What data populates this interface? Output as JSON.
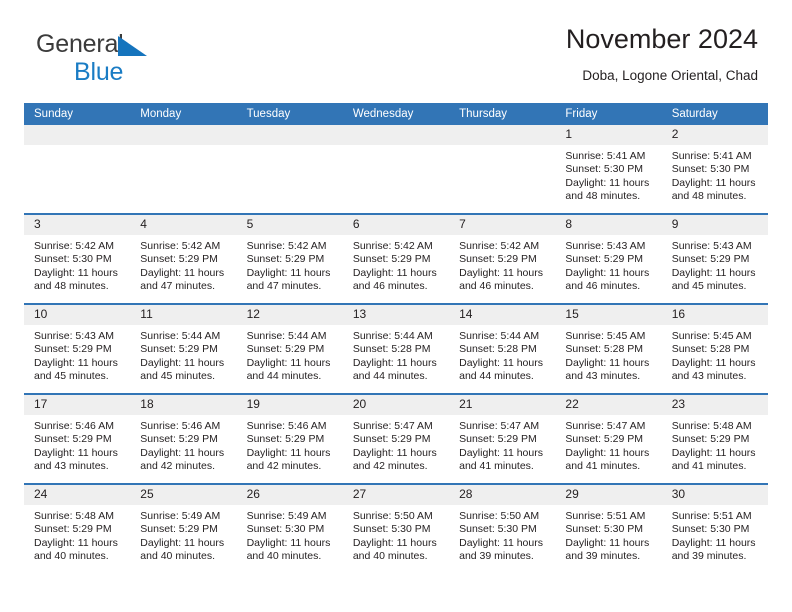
{
  "brand": {
    "name_top": "General",
    "name_bottom": "Blue",
    "triangle_color": "#1574bd",
    "text_color": "#3b3b3b",
    "blue_color": "#1a7cc4"
  },
  "header": {
    "title": "November 2024",
    "subtitle": "Doba, Logone Oriental, Chad",
    "accent_color": "#3275b6",
    "daynum_bg": "#efefef"
  },
  "weekday_headers": [
    "Sunday",
    "Monday",
    "Tuesday",
    "Wednesday",
    "Thursday",
    "Friday",
    "Saturday"
  ],
  "weeks": [
    [
      {
        "day": "",
        "lines": []
      },
      {
        "day": "",
        "lines": []
      },
      {
        "day": "",
        "lines": []
      },
      {
        "day": "",
        "lines": []
      },
      {
        "day": "",
        "lines": []
      },
      {
        "day": "1",
        "lines": [
          "Sunrise: 5:41 AM",
          "Sunset: 5:30 PM",
          "Daylight: 11 hours",
          "and 48 minutes."
        ]
      },
      {
        "day": "2",
        "lines": [
          "Sunrise: 5:41 AM",
          "Sunset: 5:30 PM",
          "Daylight: 11 hours",
          "and 48 minutes."
        ]
      }
    ],
    [
      {
        "day": "3",
        "lines": [
          "Sunrise: 5:42 AM",
          "Sunset: 5:30 PM",
          "Daylight: 11 hours",
          "and 48 minutes."
        ]
      },
      {
        "day": "4",
        "lines": [
          "Sunrise: 5:42 AM",
          "Sunset: 5:29 PM",
          "Daylight: 11 hours",
          "and 47 minutes."
        ]
      },
      {
        "day": "5",
        "lines": [
          "Sunrise: 5:42 AM",
          "Sunset: 5:29 PM",
          "Daylight: 11 hours",
          "and 47 minutes."
        ]
      },
      {
        "day": "6",
        "lines": [
          "Sunrise: 5:42 AM",
          "Sunset: 5:29 PM",
          "Daylight: 11 hours",
          "and 46 minutes."
        ]
      },
      {
        "day": "7",
        "lines": [
          "Sunrise: 5:42 AM",
          "Sunset: 5:29 PM",
          "Daylight: 11 hours",
          "and 46 minutes."
        ]
      },
      {
        "day": "8",
        "lines": [
          "Sunrise: 5:43 AM",
          "Sunset: 5:29 PM",
          "Daylight: 11 hours",
          "and 46 minutes."
        ]
      },
      {
        "day": "9",
        "lines": [
          "Sunrise: 5:43 AM",
          "Sunset: 5:29 PM",
          "Daylight: 11 hours",
          "and 45 minutes."
        ]
      }
    ],
    [
      {
        "day": "10",
        "lines": [
          "Sunrise: 5:43 AM",
          "Sunset: 5:29 PM",
          "Daylight: 11 hours",
          "and 45 minutes."
        ]
      },
      {
        "day": "11",
        "lines": [
          "Sunrise: 5:44 AM",
          "Sunset: 5:29 PM",
          "Daylight: 11 hours",
          "and 45 minutes."
        ]
      },
      {
        "day": "12",
        "lines": [
          "Sunrise: 5:44 AM",
          "Sunset: 5:29 PM",
          "Daylight: 11 hours",
          "and 44 minutes."
        ]
      },
      {
        "day": "13",
        "lines": [
          "Sunrise: 5:44 AM",
          "Sunset: 5:28 PM",
          "Daylight: 11 hours",
          "and 44 minutes."
        ]
      },
      {
        "day": "14",
        "lines": [
          "Sunrise: 5:44 AM",
          "Sunset: 5:28 PM",
          "Daylight: 11 hours",
          "and 44 minutes."
        ]
      },
      {
        "day": "15",
        "lines": [
          "Sunrise: 5:45 AM",
          "Sunset: 5:28 PM",
          "Daylight: 11 hours",
          "and 43 minutes."
        ]
      },
      {
        "day": "16",
        "lines": [
          "Sunrise: 5:45 AM",
          "Sunset: 5:28 PM",
          "Daylight: 11 hours",
          "and 43 minutes."
        ]
      }
    ],
    [
      {
        "day": "17",
        "lines": [
          "Sunrise: 5:46 AM",
          "Sunset: 5:29 PM",
          "Daylight: 11 hours",
          "and 43 minutes."
        ]
      },
      {
        "day": "18",
        "lines": [
          "Sunrise: 5:46 AM",
          "Sunset: 5:29 PM",
          "Daylight: 11 hours",
          "and 42 minutes."
        ]
      },
      {
        "day": "19",
        "lines": [
          "Sunrise: 5:46 AM",
          "Sunset: 5:29 PM",
          "Daylight: 11 hours",
          "and 42 minutes."
        ]
      },
      {
        "day": "20",
        "lines": [
          "Sunrise: 5:47 AM",
          "Sunset: 5:29 PM",
          "Daylight: 11 hours",
          "and 42 minutes."
        ]
      },
      {
        "day": "21",
        "lines": [
          "Sunrise: 5:47 AM",
          "Sunset: 5:29 PM",
          "Daylight: 11 hours",
          "and 41 minutes."
        ]
      },
      {
        "day": "22",
        "lines": [
          "Sunrise: 5:47 AM",
          "Sunset: 5:29 PM",
          "Daylight: 11 hours",
          "and 41 minutes."
        ]
      },
      {
        "day": "23",
        "lines": [
          "Sunrise: 5:48 AM",
          "Sunset: 5:29 PM",
          "Daylight: 11 hours",
          "and 41 minutes."
        ]
      }
    ],
    [
      {
        "day": "24",
        "lines": [
          "Sunrise: 5:48 AM",
          "Sunset: 5:29 PM",
          "Daylight: 11 hours",
          "and 40 minutes."
        ]
      },
      {
        "day": "25",
        "lines": [
          "Sunrise: 5:49 AM",
          "Sunset: 5:29 PM",
          "Daylight: 11 hours",
          "and 40 minutes."
        ]
      },
      {
        "day": "26",
        "lines": [
          "Sunrise: 5:49 AM",
          "Sunset: 5:30 PM",
          "Daylight: 11 hours",
          "and 40 minutes."
        ]
      },
      {
        "day": "27",
        "lines": [
          "Sunrise: 5:50 AM",
          "Sunset: 5:30 PM",
          "Daylight: 11 hours",
          "and 40 minutes."
        ]
      },
      {
        "day": "28",
        "lines": [
          "Sunrise: 5:50 AM",
          "Sunset: 5:30 PM",
          "Daylight: 11 hours",
          "and 39 minutes."
        ]
      },
      {
        "day": "29",
        "lines": [
          "Sunrise: 5:51 AM",
          "Sunset: 5:30 PM",
          "Daylight: 11 hours",
          "and 39 minutes."
        ]
      },
      {
        "day": "30",
        "lines": [
          "Sunrise: 5:51 AM",
          "Sunset: 5:30 PM",
          "Daylight: 11 hours",
          "and 39 minutes."
        ]
      }
    ]
  ]
}
